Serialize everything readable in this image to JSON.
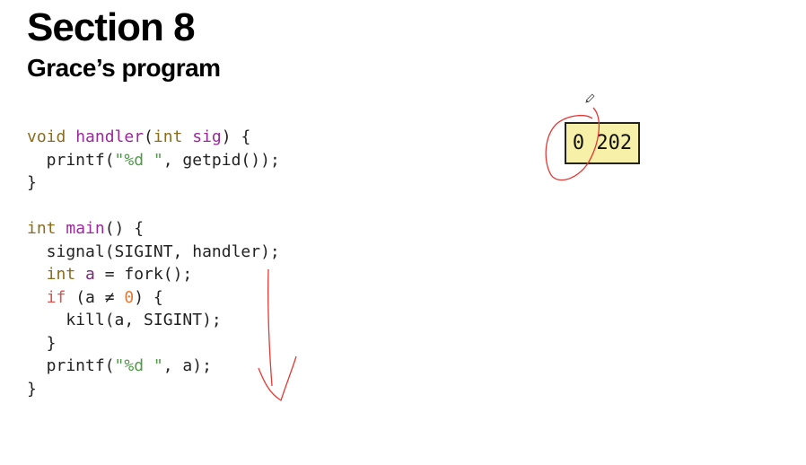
{
  "slide": {
    "title": "Section 8",
    "subtitle": "Grace’s program"
  },
  "code": [
    [
      {
        "t": "void ",
        "c": "kw"
      },
      {
        "t": "handler",
        "c": "fn"
      },
      {
        "t": "(",
        "c": ""
      },
      {
        "t": "int ",
        "c": "kw"
      },
      {
        "t": "sig",
        "c": "fn"
      },
      {
        "t": ") {",
        "c": ""
      }
    ],
    [
      {
        "t": "  printf(",
        "c": ""
      },
      {
        "t": "\"%d \"",
        "c": "str"
      },
      {
        "t": ", getpid());",
        "c": ""
      }
    ],
    [
      {
        "t": "}",
        "c": ""
      }
    ],
    [
      {
        "t": " ",
        "c": ""
      }
    ],
    [
      {
        "t": "int ",
        "c": "kw"
      },
      {
        "t": "main",
        "c": "fn"
      },
      {
        "t": "() {",
        "c": ""
      }
    ],
    [
      {
        "t": "  signal(SIGINT, handler);",
        "c": ""
      }
    ],
    [
      {
        "t": "  int ",
        "c": "kw"
      },
      {
        "t": "a",
        "c": "var"
      },
      {
        "t": " = fork();",
        "c": ""
      }
    ],
    [
      {
        "t": "  if",
        "c": "ctl"
      },
      {
        "t": " (a ≠ ",
        "c": ""
      },
      {
        "t": "0",
        "c": "num"
      },
      {
        "t": ") {",
        "c": ""
      }
    ],
    [
      {
        "t": "    kill(a, SIGINT);",
        "c": ""
      }
    ],
    [
      {
        "t": "  }",
        "c": ""
      }
    ],
    [
      {
        "t": "  printf(",
        "c": ""
      },
      {
        "t": "\"%d \"",
        "c": "str"
      },
      {
        "t": ", a);",
        "c": ""
      }
    ],
    [
      {
        "t": "}",
        "c": ""
      }
    ]
  ],
  "output_box": {
    "text": "0 202"
  },
  "annotation_color": "#e53935"
}
